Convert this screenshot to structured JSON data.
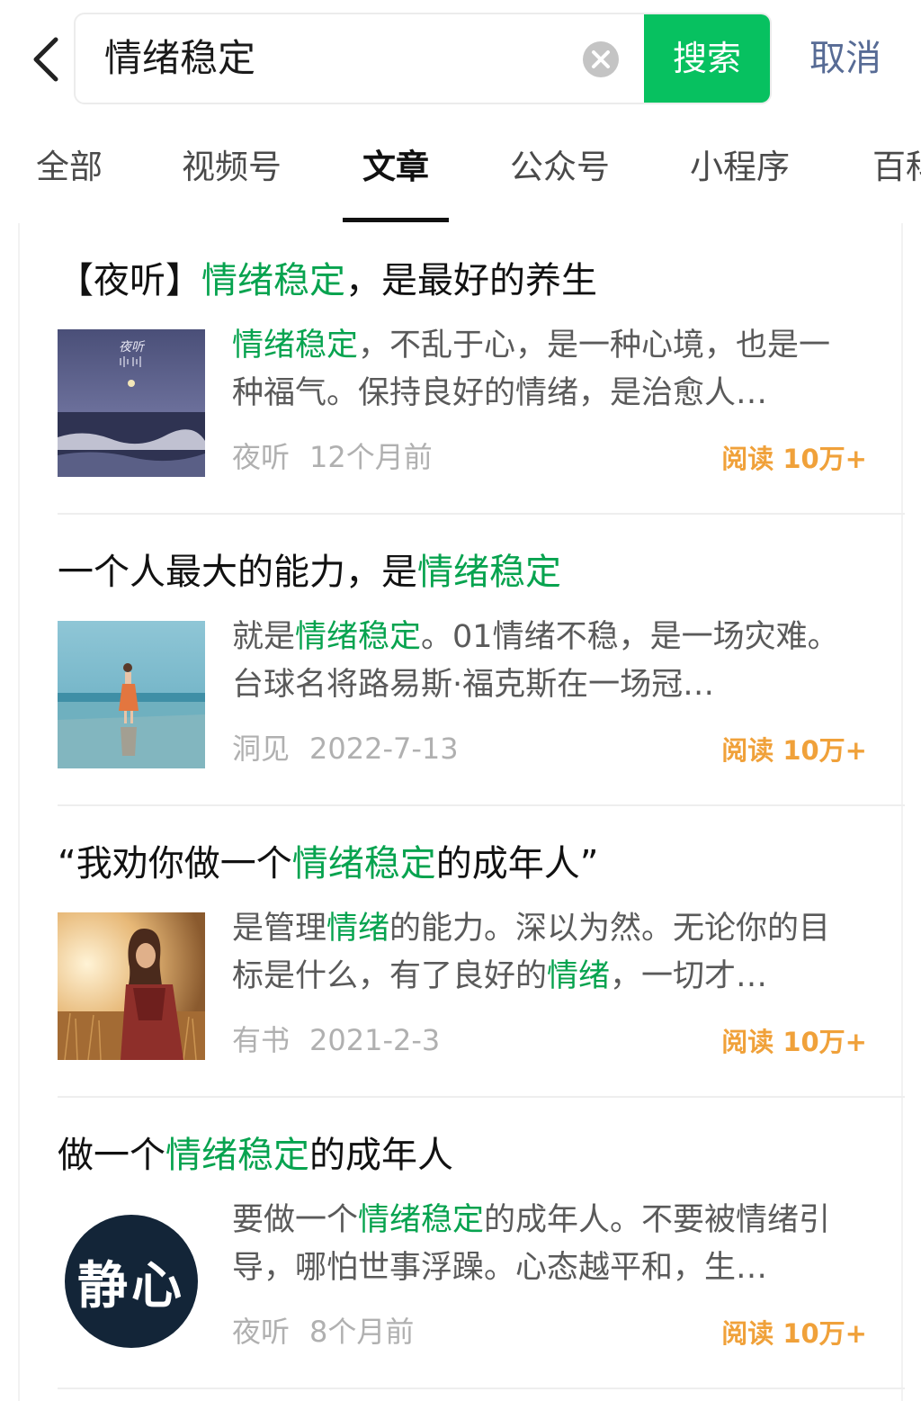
{
  "search": {
    "query": "情绪稳定",
    "search_label": "搜索",
    "cancel_label": "取消"
  },
  "tabs": [
    {
      "label": "全部",
      "active": false
    },
    {
      "label": "视频号",
      "active": false
    },
    {
      "label": "文章",
      "active": true
    },
    {
      "label": "公众号",
      "active": false
    },
    {
      "label": "小程序",
      "active": false
    },
    {
      "label": "百科",
      "active": false
    }
  ],
  "results": [
    {
      "title": [
        {
          "text": "【夜听】"
        },
        {
          "text": "情绪稳定",
          "hl": true
        },
        {
          "text": "，是最好的养生"
        }
      ],
      "desc": [
        {
          "text": "情绪稳定",
          "hl": true
        },
        {
          "text": "，不乱于心，是一种心境，也是一种福气。保持良好的情绪，是治愈人…"
        }
      ],
      "source": "夜听",
      "time": "12个月前",
      "reads": "阅读 10万+",
      "thumb_icon": "night-sea-thumbnail",
      "thumb_text": "夜听"
    },
    {
      "title": [
        {
          "text": "一个人最大的能力，是"
        },
        {
          "text": "情绪稳定",
          "hl": true
        }
      ],
      "desc": [
        {
          "text": "就是"
        },
        {
          "text": "情绪稳定",
          "hl": true
        },
        {
          "text": "。01情绪不稳，是一场灾难。台球名将路易斯·福克斯在一场冠…"
        }
      ],
      "source": "洞见",
      "time": "2022-7-13",
      "reads": "阅读 10万+",
      "thumb_icon": "beach-woman-thumbnail"
    },
    {
      "title": [
        {
          "text": "“我劝你做一个"
        },
        {
          "text": "情绪稳定",
          "hl": true
        },
        {
          "text": "的成年人”"
        }
      ],
      "desc": [
        {
          "text": "是管理"
        },
        {
          "text": "情绪",
          "hl": true
        },
        {
          "text": "的能力。深以为然。无论你的目标是什么，有了良好的"
        },
        {
          "text": "情绪",
          "hl": true
        },
        {
          "text": "，一切才…"
        }
      ],
      "source": "有书",
      "time": "2021-2-3",
      "reads": "阅读 10万+",
      "thumb_icon": "field-woman-thumbnail"
    },
    {
      "title": [
        {
          "text": "做一个"
        },
        {
          "text": "情绪稳定",
          "hl": true
        },
        {
          "text": "的成年人"
        }
      ],
      "desc": [
        {
          "text": "要做一个"
        },
        {
          "text": "情绪稳定",
          "hl": true
        },
        {
          "text": "的成年人。不要被情绪引导，哪怕世事浮躁。心态越平和，生…"
        }
      ],
      "source": "夜听",
      "time": "8个月前",
      "reads": "阅读 10万+",
      "thumb_icon": "jingxin-circle-thumbnail",
      "thumb_text": "静心"
    }
  ],
  "colors": {
    "accent_green": "#07c160",
    "highlight_green": "#07a34f",
    "reads_orange": "#f0a13a",
    "cancel_blue": "#576b95"
  }
}
